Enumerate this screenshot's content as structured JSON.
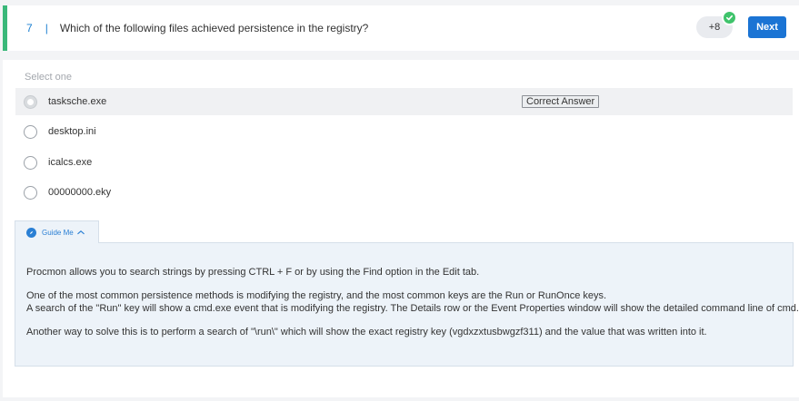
{
  "question": {
    "number": "7",
    "separator": "|",
    "text": "Which of the following files achieved persistence in the registry?"
  },
  "points": {
    "label": "+8",
    "awarded": true
  },
  "next_button": "Next",
  "select_hint": "Select one",
  "options": [
    {
      "label": "tasksche.exe",
      "selected": true
    },
    {
      "label": "desktop.ini",
      "selected": false
    },
    {
      "label": "icalcs.exe",
      "selected": false
    },
    {
      "label": "00000000.eky",
      "selected": false
    }
  ],
  "correct_badge": "Correct Answer",
  "guide": {
    "tab_label": "Guide Me",
    "paragraphs": [
      "Procmon allows you to search strings by pressing CTRL + F or by using the Find option in the Edit tab.",
      "One of the most common persistence methods is modifying the registry, and the most common keys are the Run or RunOnce keys.",
      "A search of the \"Run\" key will show a cmd.exe event that is modifying the registry. The Details row or the Event Properties window will show the detailed command line of cmd.exe.",
      "Another way to solve this is to perform a search of \"\\run\\\" which will show the exact registry key (vgdxzxtusbwgzf311) and the value that was written into it."
    ]
  },
  "colors": {
    "accent": "#1b74d4",
    "success": "#3fc36b",
    "header_bar": "#3ab87a",
    "guide_bg": "#edf3f9"
  }
}
